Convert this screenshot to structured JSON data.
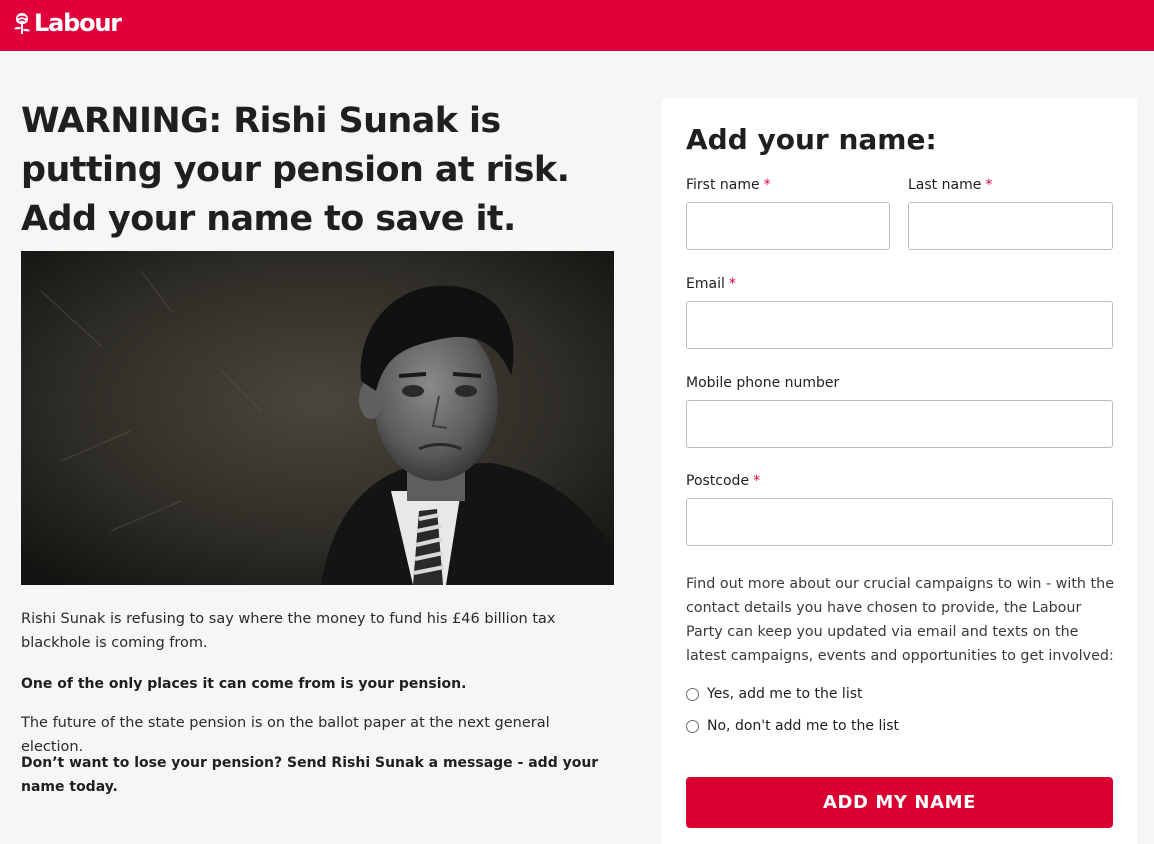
{
  "colors": {
    "brand": "#e0003a",
    "button": "#d8002f",
    "required": "#e0003a"
  },
  "header": {
    "logo_text": "Labour",
    "logo_icon": "rose-icon"
  },
  "main": {
    "headline": "WARNING: Rishi Sunak is putting your pension at risk. Add your name to save it.",
    "paragraphs": [
      "Rishi Sunak is refusing to say where the money to fund his £46 billion tax blackhole is coming from.",
      "One of the only places it can come from is your pension.",
      "The future of the state pension is on the ballot paper at the next general election.",
      "Don’t want to lose your pension? Send Rishi Sunak a message - add your name today."
    ]
  },
  "form": {
    "title": "Add your name:",
    "required_mark": "*",
    "fields": {
      "first_name": {
        "label": "First name",
        "value": "",
        "placeholder": ""
      },
      "last_name": {
        "label": "Last name",
        "value": "",
        "placeholder": ""
      },
      "email": {
        "label": "Email",
        "value": "",
        "placeholder": ""
      },
      "mobile": {
        "label": "Mobile phone number",
        "value": "",
        "placeholder": ""
      },
      "postcode": {
        "label": "Postcode",
        "value": "",
        "placeholder": ""
      }
    },
    "consent_text": "Find out more about our crucial campaigns to win - with the contact details you have chosen to provide, the Labour Party can keep you updated via email and texts on the latest campaigns, events and opportunities to get involved:",
    "options": [
      "Yes, add me to the list",
      "No, don't add me to the list"
    ],
    "submit_label": "ADD MY NAME"
  }
}
